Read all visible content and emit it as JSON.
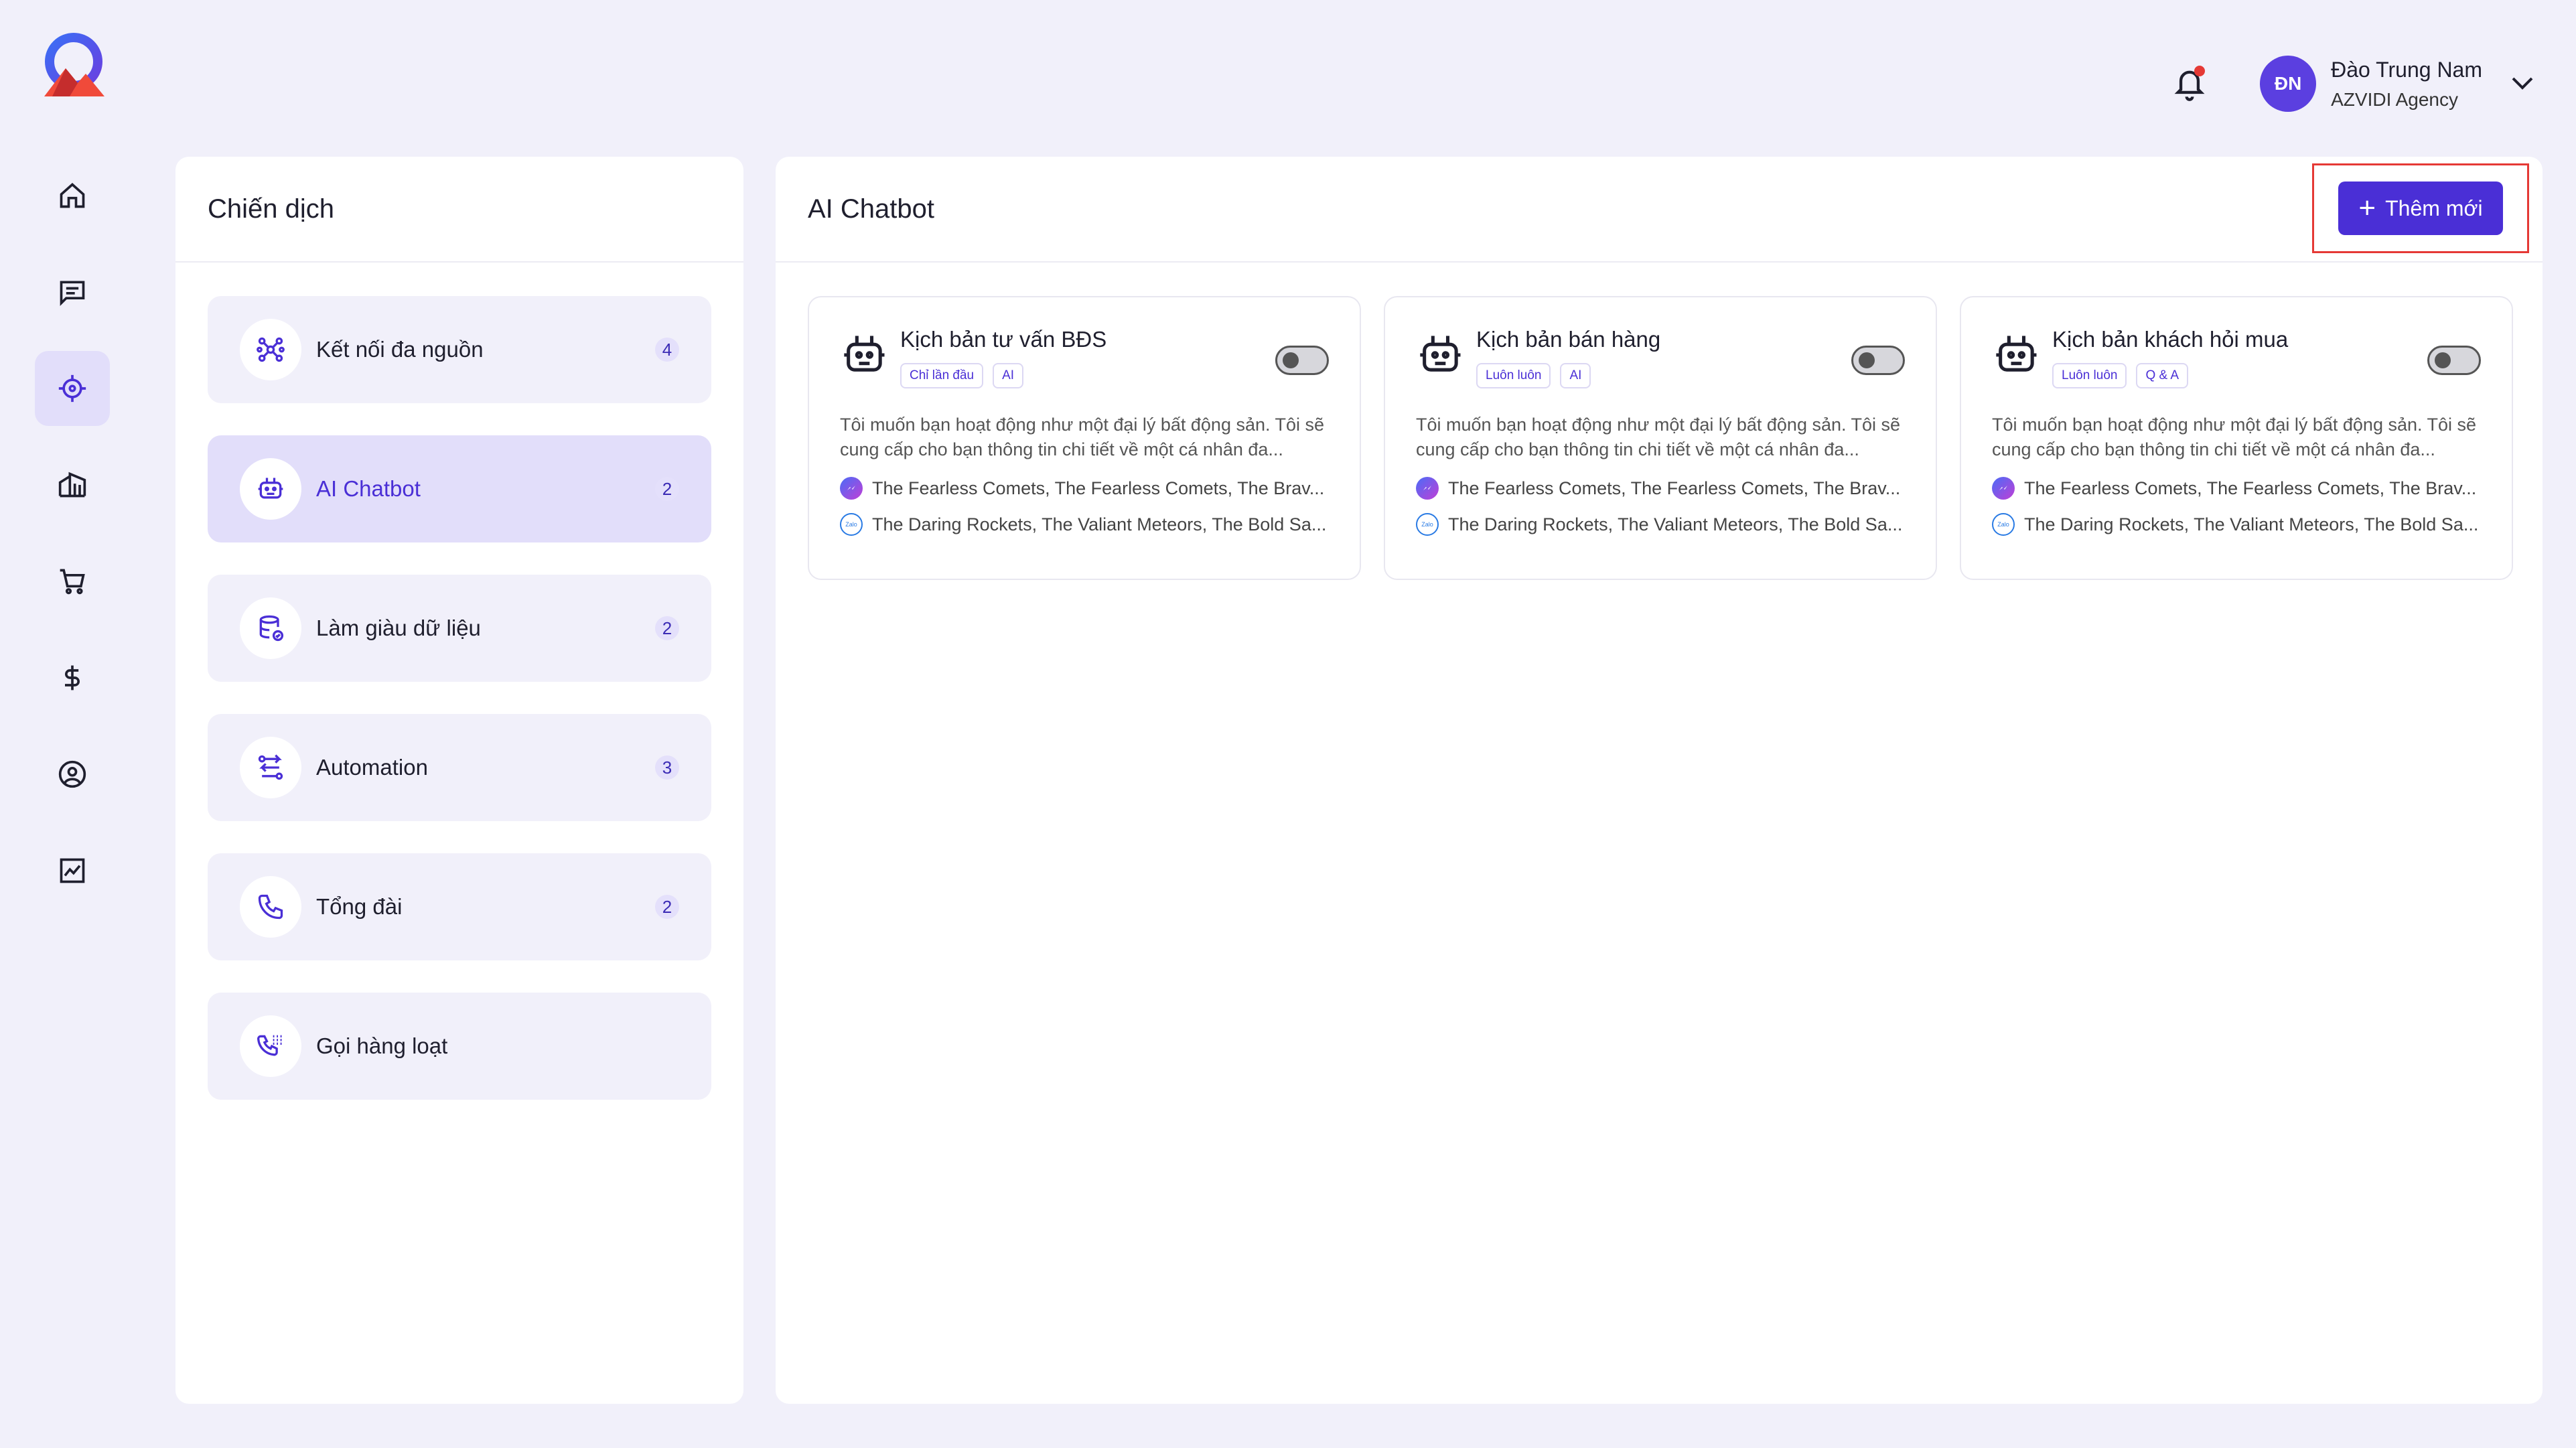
{
  "header": {
    "user_initials": "ĐN",
    "user_name": "Đào Trung Nam",
    "user_org": "AZVIDI Agency"
  },
  "rail": {
    "items": [
      {
        "icon": "home-icon"
      },
      {
        "icon": "chat-icon"
      },
      {
        "icon": "target-icon",
        "active": true
      },
      {
        "icon": "building-icon"
      },
      {
        "icon": "cart-icon"
      },
      {
        "icon": "dollar-icon"
      },
      {
        "icon": "user-circle-icon"
      },
      {
        "icon": "chart-icon"
      }
    ]
  },
  "left_panel": {
    "title": "Chiến dịch",
    "items": [
      {
        "label": "Kết nối đa nguồn",
        "count": "4",
        "icon": "network-icon"
      },
      {
        "label": "AI Chatbot",
        "count": "2",
        "icon": "bot-icon",
        "active": true
      },
      {
        "label": "Làm giàu dữ liệu",
        "count": "2",
        "icon": "database-icon"
      },
      {
        "label": "Automation",
        "count": "3",
        "icon": "workflow-icon"
      },
      {
        "label": "Tổng đài",
        "count": "2",
        "icon": "phone-icon"
      },
      {
        "label": "Gọi hàng loạt",
        "count": "",
        "icon": "bulk-call-icon"
      }
    ]
  },
  "main": {
    "title": "AI Chatbot",
    "add_label": "Thêm mới",
    "cards": [
      {
        "title": "Kịch bản tư vấn BĐS",
        "tags": [
          "Chỉ lần đầu",
          "AI"
        ],
        "desc": "Tôi muốn bạn hoạt động như một đại lý bất động sản. Tôi sẽ cung cấp cho bạn thông tin chi tiết về một cá nhân đa...",
        "messenger": "The Fearless Comets, The Fearless Comets, The Brav...",
        "zalo": "The Daring Rockets, The Valiant Meteors, The Bold Sa..."
      },
      {
        "title": "Kịch bản bán hàng",
        "tags": [
          "Luôn luôn",
          "AI"
        ],
        "desc": "Tôi muốn bạn hoạt động như một đại lý bất động sản. Tôi sẽ cung cấp cho bạn thông tin chi tiết về một cá nhân đa...",
        "messenger": "The Fearless Comets, The Fearless Comets, The Brav...",
        "zalo": "The Daring Rockets, The Valiant Meteors, The Bold Sa..."
      },
      {
        "title": "Kịch bản khách hỏi mua",
        "tags": [
          "Luôn luôn",
          "Q & A"
        ],
        "desc": "Tôi muốn bạn hoạt động như một đại lý bất động sản. Tôi sẽ cung cấp cho bạn thông tin chi tiết về một cá nhân đa...",
        "messenger": "The Fearless Comets, The Fearless Comets, The Brav...",
        "zalo": "The Daring Rockets, The Valiant Meteors, The Bold Sa..."
      }
    ]
  },
  "colors": {
    "accent": "#4a2fd6",
    "background": "#f1f0fa",
    "highlight": "#e53935"
  }
}
